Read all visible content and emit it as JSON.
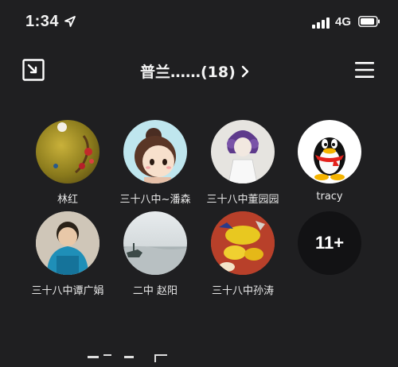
{
  "status": {
    "time": "1:34",
    "network": "4G"
  },
  "header": {
    "title": "普兰……(18)"
  },
  "members": [
    {
      "name": "林红"
    },
    {
      "name": "三十八中~潘森"
    },
    {
      "name": "三十八中董园园"
    },
    {
      "name": "tracy"
    },
    {
      "name": "三十八中谭广娟"
    },
    {
      "name": "二中 赵阳"
    },
    {
      "name": "三十八中孙涛"
    }
  ],
  "more": {
    "label": "11+"
  },
  "icons": {
    "location": "location-arrow-icon",
    "signal": "signal-icon",
    "battery": "battery-icon",
    "minimize": "minimize-icon",
    "chevron": "chevron-right-icon",
    "menu": "menu-icon"
  },
  "colors": {
    "background": "#1f1f21",
    "text": "#f2f2f2",
    "more_circle": "#121214"
  }
}
